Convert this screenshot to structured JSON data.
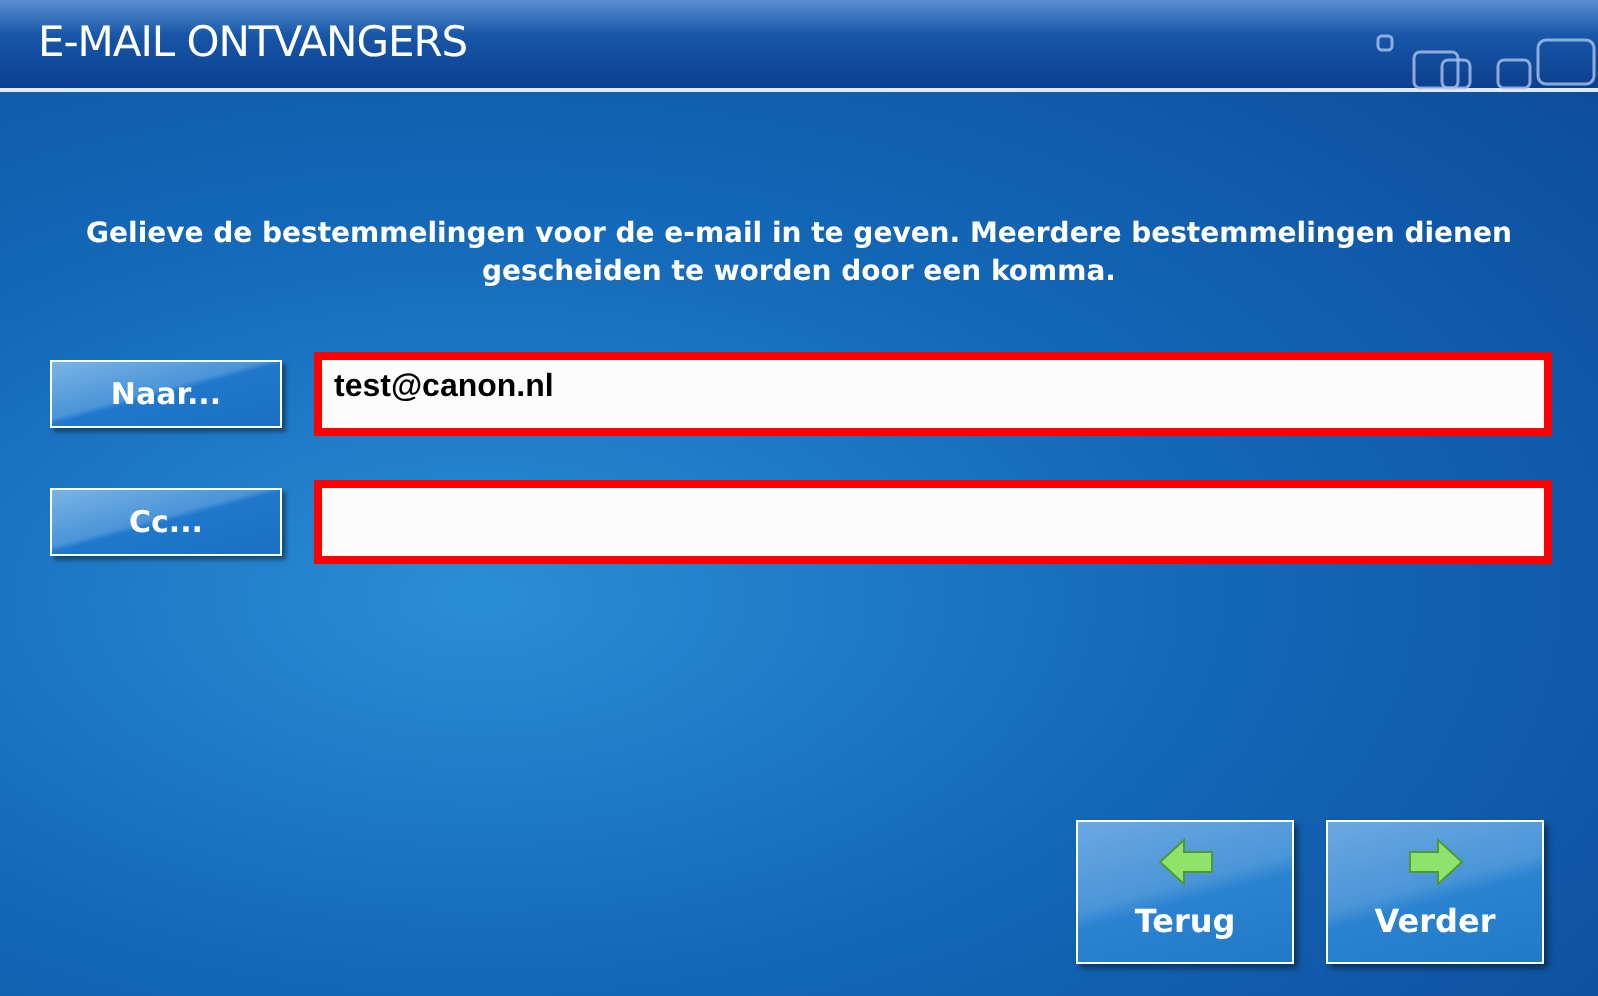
{
  "window": {
    "title": "E-MAIL ONTVANGERS"
  },
  "instruction": "Gelieve de bestemmelingen voor de e-mail in te geven. Meerdere bestemmelingen dienen gescheiden te worden door een komma.",
  "fields": [
    {
      "button": "Naar...",
      "value": "test@canon.nl"
    },
    {
      "button": "Cc..."
    }
  ],
  "nav_buttons": [
    {
      "label": "Terug",
      "kind": "back"
    },
    {
      "label": "Verder",
      "kind": "next"
    }
  ]
}
